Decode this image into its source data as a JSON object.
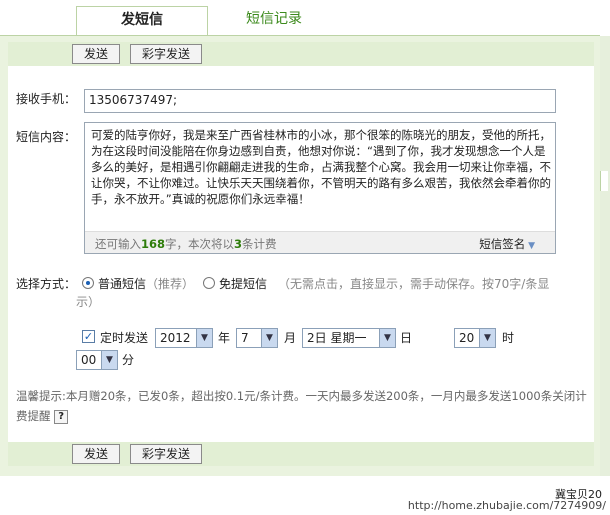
{
  "tabs": {
    "active": "发短信",
    "inactive": "短信记录"
  },
  "toolbar": {
    "send": "发送",
    "color_send": "彩字发送"
  },
  "phone": {
    "label": "接收手机：",
    "value": "13506737497;"
  },
  "message": {
    "label": "短信内容：",
    "text": "可爱的陆亨你好，我是来至广西省桂林市的小冰，那个很笨的陈晓光的朋友，受他的所托，为在这段时间没能陪在你身边感到自责，他想对你说：“遇到了你，我才发现想念一个人是多么的美好，是相遇引你翩翩走进我的生命，占满我整个心窝。我会用一切来让你幸福，不让你哭，不让你难过。让快乐天天围绕着你，不管明天的路有多么艰苦，我依然会牵着你的手，永不放开。”真诚的祝愿你们永远幸福！",
    "remain_pre": "还可输入",
    "remain_count": "168",
    "remain_mid": "字，本次将以",
    "remain_num": "3",
    "remain_post": "条计费",
    "signature": "短信签名"
  },
  "mode": {
    "label": "选择方式：",
    "normal": "普通短信",
    "normal_note": "（推荐）",
    "free": "免提短信",
    "free_note": "（无需点击，直接显示，需手动保存。按70字/条显示）"
  },
  "schedule": {
    "checked": true,
    "label": "定时发送",
    "year": "2012",
    "year_unit": "年",
    "month": "7",
    "month_unit": "月",
    "day": "2日 星期一",
    "day_unit": "日",
    "hour": "20",
    "hour_unit": "时",
    "minute": "00",
    "minute_unit": "分"
  },
  "tip": {
    "text": "温馨提示:本月赠20条，已发0条，超出按0.1元/条计费。一天内最多发送200条，一月内最多发送1000条关闭计费提醒",
    "icon": "?"
  },
  "watermark": {
    "line1": "冀宝贝20",
    "line2": "http://home.zhubajie.com/7274909/"
  }
}
